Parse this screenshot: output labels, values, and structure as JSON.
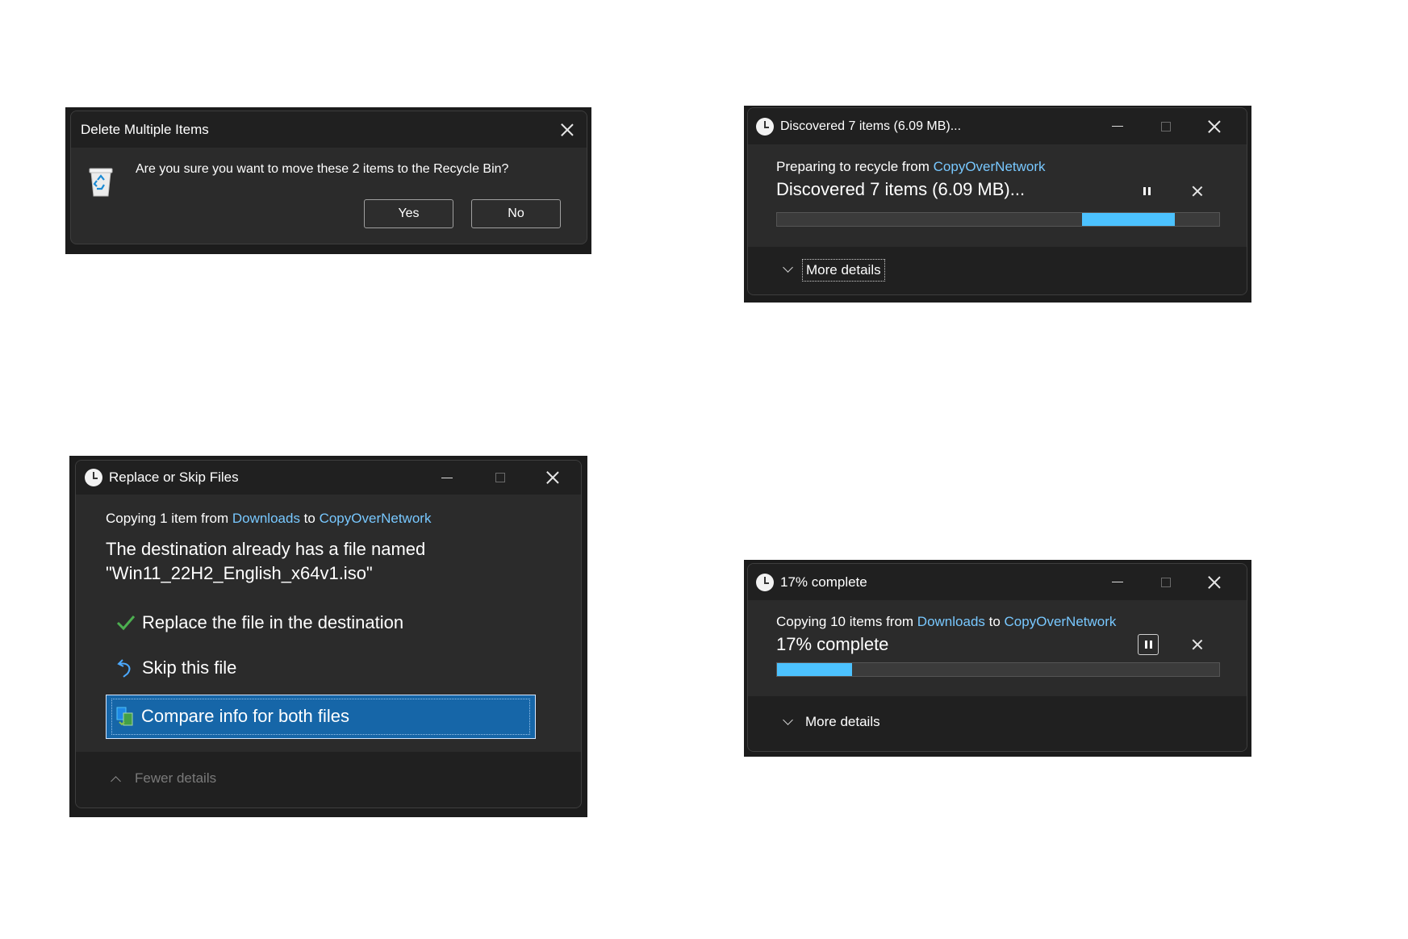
{
  "delete_dialog": {
    "title": "Delete Multiple Items",
    "icon": "recycle-bin-icon",
    "message": "Are you sure you want to move these 2 items to the Recycle Bin?",
    "yes_label": "Yes",
    "no_label": "No"
  },
  "discover_dialog": {
    "title": "Discovered 7 items (6.09 MB)...",
    "status_prefix": "Preparing to recycle from ",
    "status_link": "CopyOverNetwork",
    "headline": "Discovered 7 items (6.09 MB)...",
    "more_details_label": "More details"
  },
  "replace_dialog": {
    "title": "Replace or Skip Files",
    "copy_prefix": "Copying 1 item from ",
    "source_link": "Downloads",
    "copy_middle": " to ",
    "dest_link": "CopyOverNetwork",
    "message_line1": "The destination already has a file named",
    "message_line2": "\"Win11_22H2_English_x64v1.iso\"",
    "options": {
      "replace": "Replace the file in the destination",
      "skip": "Skip this file",
      "compare": "Compare info for both files"
    },
    "fewer_details_label": "Fewer details"
  },
  "progress_dialog": {
    "title": "17% complete",
    "copy_prefix": "Copying 10 items from ",
    "source_link": "Downloads",
    "copy_middle": " to ",
    "dest_link": "CopyOverNetwork",
    "headline": "17% complete",
    "progress_fraction": 0.17,
    "more_details_label": "More details"
  },
  "colors": {
    "accent": "#4cc2ff",
    "link": "#78c8ff",
    "selection": "#1666a8"
  }
}
